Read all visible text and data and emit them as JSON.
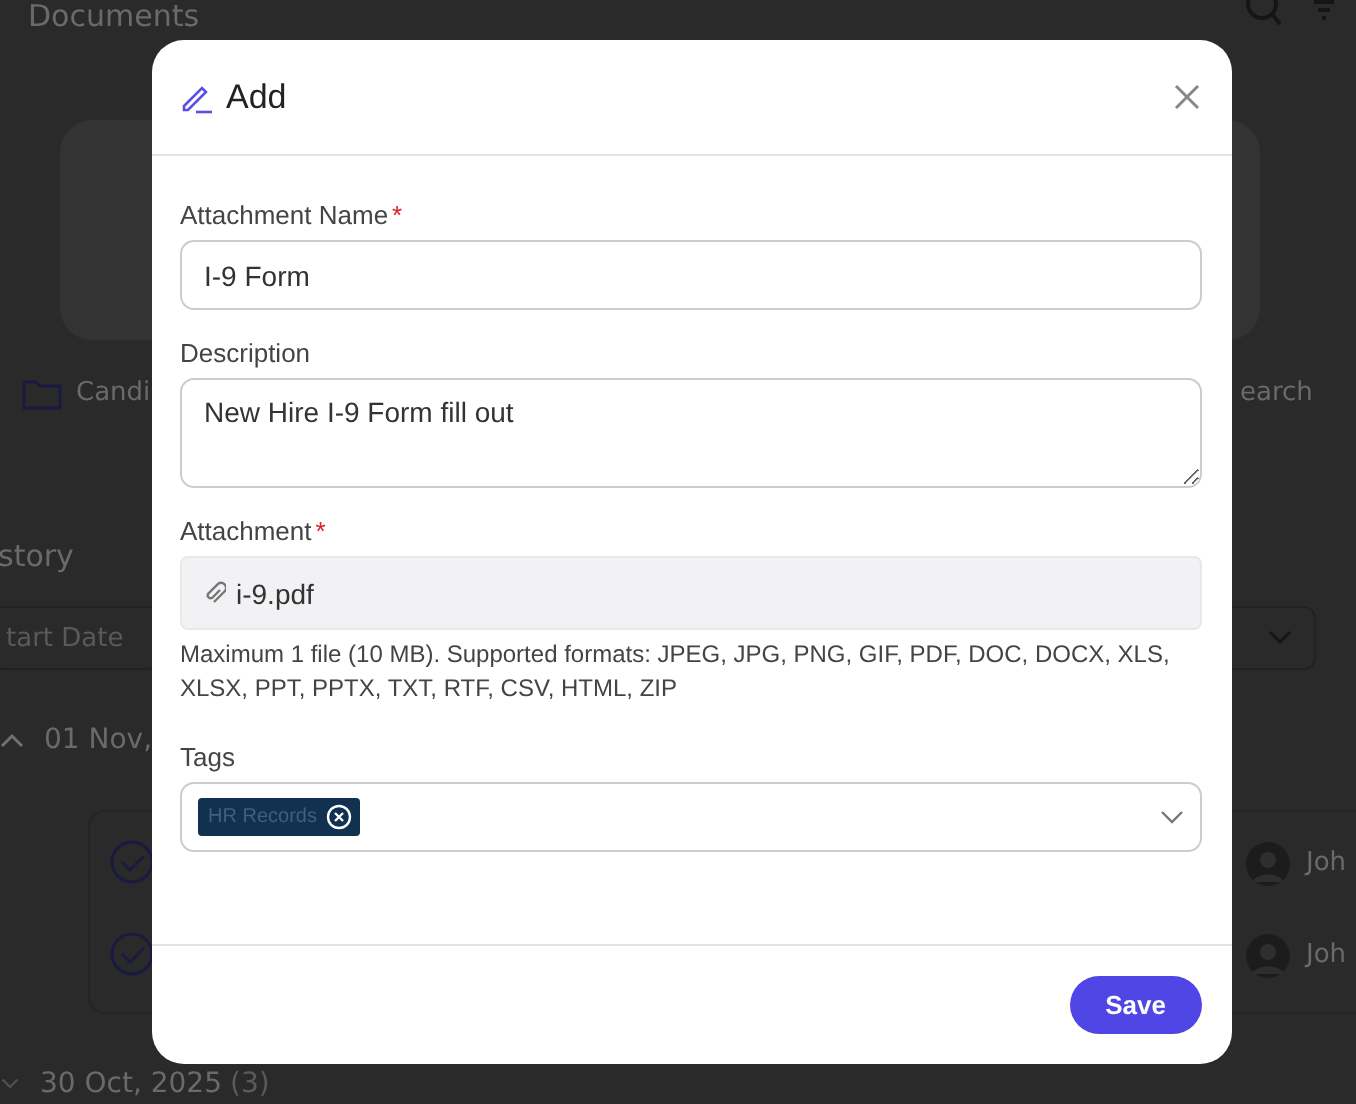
{
  "page": {
    "title": "Documents",
    "folder_label": "Candi",
    "search_label": "earch",
    "section_title": "story",
    "start_date_placeholder": "tart Date",
    "groups": [
      {
        "date": "01 Nov,",
        "expanded": true,
        "rows": [
          {
            "name": "Joh"
          },
          {
            "name": "Joh"
          }
        ]
      },
      {
        "date": "30 Oct, 2025",
        "count": "(3)",
        "expanded": false
      }
    ]
  },
  "dialog": {
    "title": "Add",
    "fields": [
      {
        "kind": "input",
        "label": "Attachment Name",
        "required_mark": "*",
        "value": "I-9 Form"
      },
      {
        "kind": "textarea",
        "label": "Description",
        "value": "New Hire I-9 Form fill out"
      },
      {
        "kind": "file",
        "label": "Attachment",
        "required_mark": "*",
        "value": "i-9.pdf",
        "hint": "Maximum 1 file (10 MB). Supported formats: JPEG, JPG, PNG, GIF, PDF, DOC, DOCX, XLS, XLSX, PPT, PPTX, TXT, RTF, CSV, HTML, ZIP"
      },
      {
        "kind": "tags",
        "label": "Tags",
        "tags": [
          "HR Records"
        ]
      }
    ],
    "buttons": [
      "Save"
    ]
  }
}
